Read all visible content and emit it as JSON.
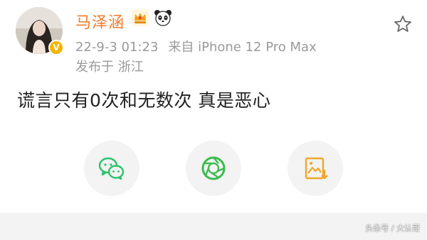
{
  "post": {
    "username": "马泽涵",
    "date": "22-9-3 01:23",
    "source": "来自 iPhone 12 Pro Max",
    "location": "发布于 浙江",
    "text": "谎言只有0次和无数次 真是恶心"
  },
  "icons": {
    "verified": "verified-v-icon",
    "crown_badge": "crown-badge-icon",
    "panda_badge": "panda-icon",
    "favorite": "star-outline-icon",
    "share_wechat": "wechat-icon",
    "share_moments": "moments-aperture-icon",
    "share_save_image": "save-image-icon"
  },
  "colors": {
    "username": "#f07c2e",
    "meta": "#9a9a9a",
    "text": "#222222",
    "wechat": "#2bc26b",
    "moments": "#3dbb4f",
    "save_image": "#f2a52b",
    "verified": "#f4b400"
  },
  "watermark": "头条号 / 大认哥"
}
